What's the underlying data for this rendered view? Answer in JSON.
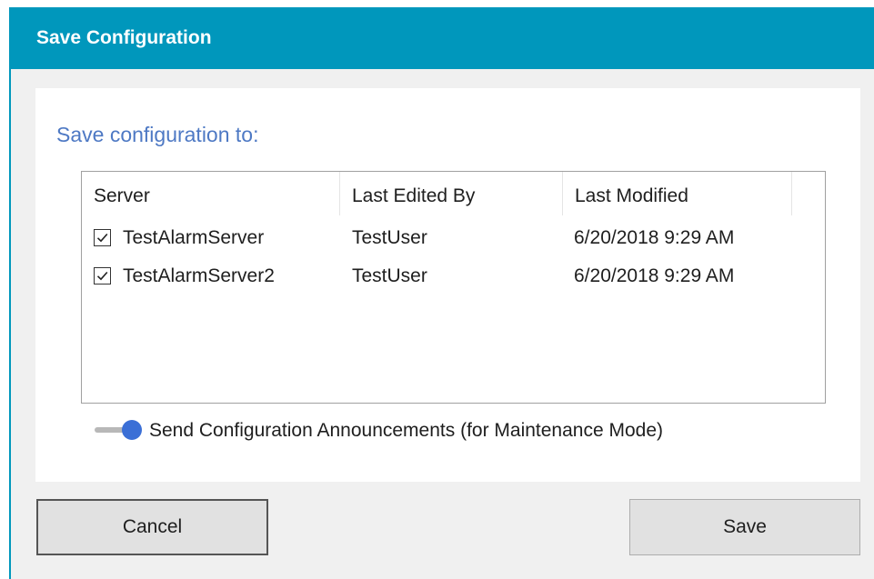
{
  "window": {
    "title": "Save Configuration"
  },
  "heading": "Save configuration to:",
  "list": {
    "columns": [
      "Server",
      "Last Edited By",
      "Last Modified"
    ],
    "rows": [
      {
        "checked": true,
        "server": "TestAlarmServer",
        "edited_by": "TestUser",
        "modified": "6/20/2018 9:29 AM"
      },
      {
        "checked": true,
        "server": "TestAlarmServer2",
        "edited_by": "TestUser",
        "modified": "6/20/2018 9:29 AM"
      }
    ]
  },
  "toggle": {
    "label": "Send Configuration Announcements (for Maintenance Mode)",
    "on": true
  },
  "buttons": {
    "cancel": "Cancel",
    "save": "Save"
  },
  "colors": {
    "titlebar": "#0097bc",
    "heading": "#4e79c4",
    "toggle_knob": "#3b6fd6"
  },
  "icons": {
    "checkbox": "checkbox-checked-icon",
    "toggle": "toggle-switch-icon"
  }
}
